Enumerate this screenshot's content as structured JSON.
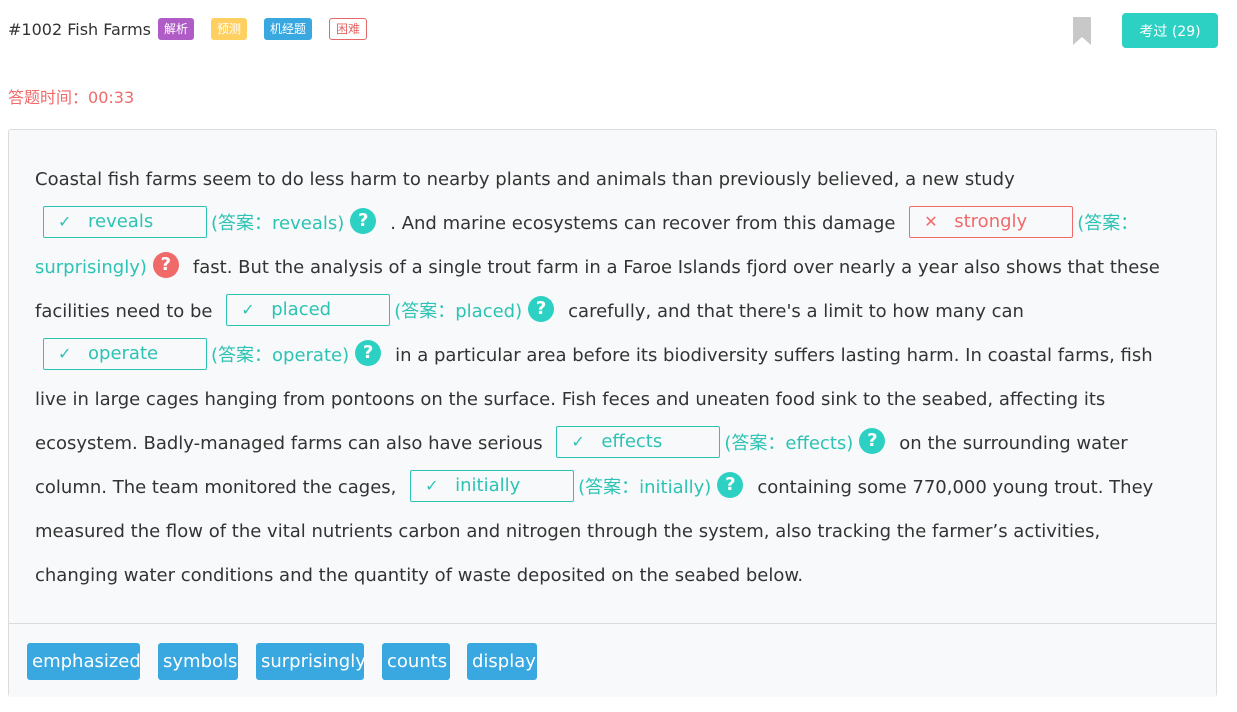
{
  "header": {
    "title": "#1002 Fish Farms",
    "tags": [
      "解析",
      "预测",
      "机经题",
      "困难"
    ],
    "exam_button": "考过 (29)"
  },
  "timer": {
    "label": "答题时间：",
    "value": "00:33"
  },
  "passage": {
    "t0": "Coastal fish farms seem to do less harm to nearby plants and animals than previously believed, a new study",
    "t1": ". And marine ecosystems can recover from this damage",
    "t2": "fast. But the analysis of a single trout farm in a Faroe Islands fjord over nearly a year also shows that these facilities need to be",
    "t3": "carefully, and that there's a limit to how many can",
    "t4": "in a particular area before its biodiversity suffers lasting harm. In coastal farms, fish live in large cages hanging from pontoons on the surface. Fish feces and uneaten food sink to the seabed, affecting its ecosystem. Badly-managed farms can also have serious",
    "t5": "on the surrounding water column. The team monitored the cages,",
    "t6": "containing some 770,000 young trout. They measured the flow of the vital nutrients carbon and nitrogen through the system, also tracking the farmer’s activities, changing water conditions and the quantity of waste deposited on the seabed below."
  },
  "blanks": [
    {
      "mark": "✓",
      "value": "reveals",
      "answer": "(答案：reveals)",
      "status": "correct"
    },
    {
      "mark": "✕",
      "value": "strongly",
      "answer": "(答案：surprisingly)",
      "status": "wrong"
    },
    {
      "mark": "✓",
      "value": "placed",
      "answer": "(答案：placed)",
      "status": "correct"
    },
    {
      "mark": "✓",
      "value": "operate",
      "answer": "(答案：operate)",
      "status": "correct"
    },
    {
      "mark": "✓",
      "value": "effects",
      "answer": "(答案：effects)",
      "status": "correct"
    },
    {
      "mark": "✓",
      "value": "initially",
      "answer": "(答案：initially)",
      "status": "correct"
    }
  ],
  "help_glyph": "?",
  "word_bank": [
    "emphasized",
    "symbols",
    "surprisingly",
    "counts",
    "display"
  ],
  "colors": {
    "accent": "#2dd1c4",
    "correct": "#2dc3b4",
    "wrong": "#f06a6a",
    "chip": "#3aa8e0"
  }
}
